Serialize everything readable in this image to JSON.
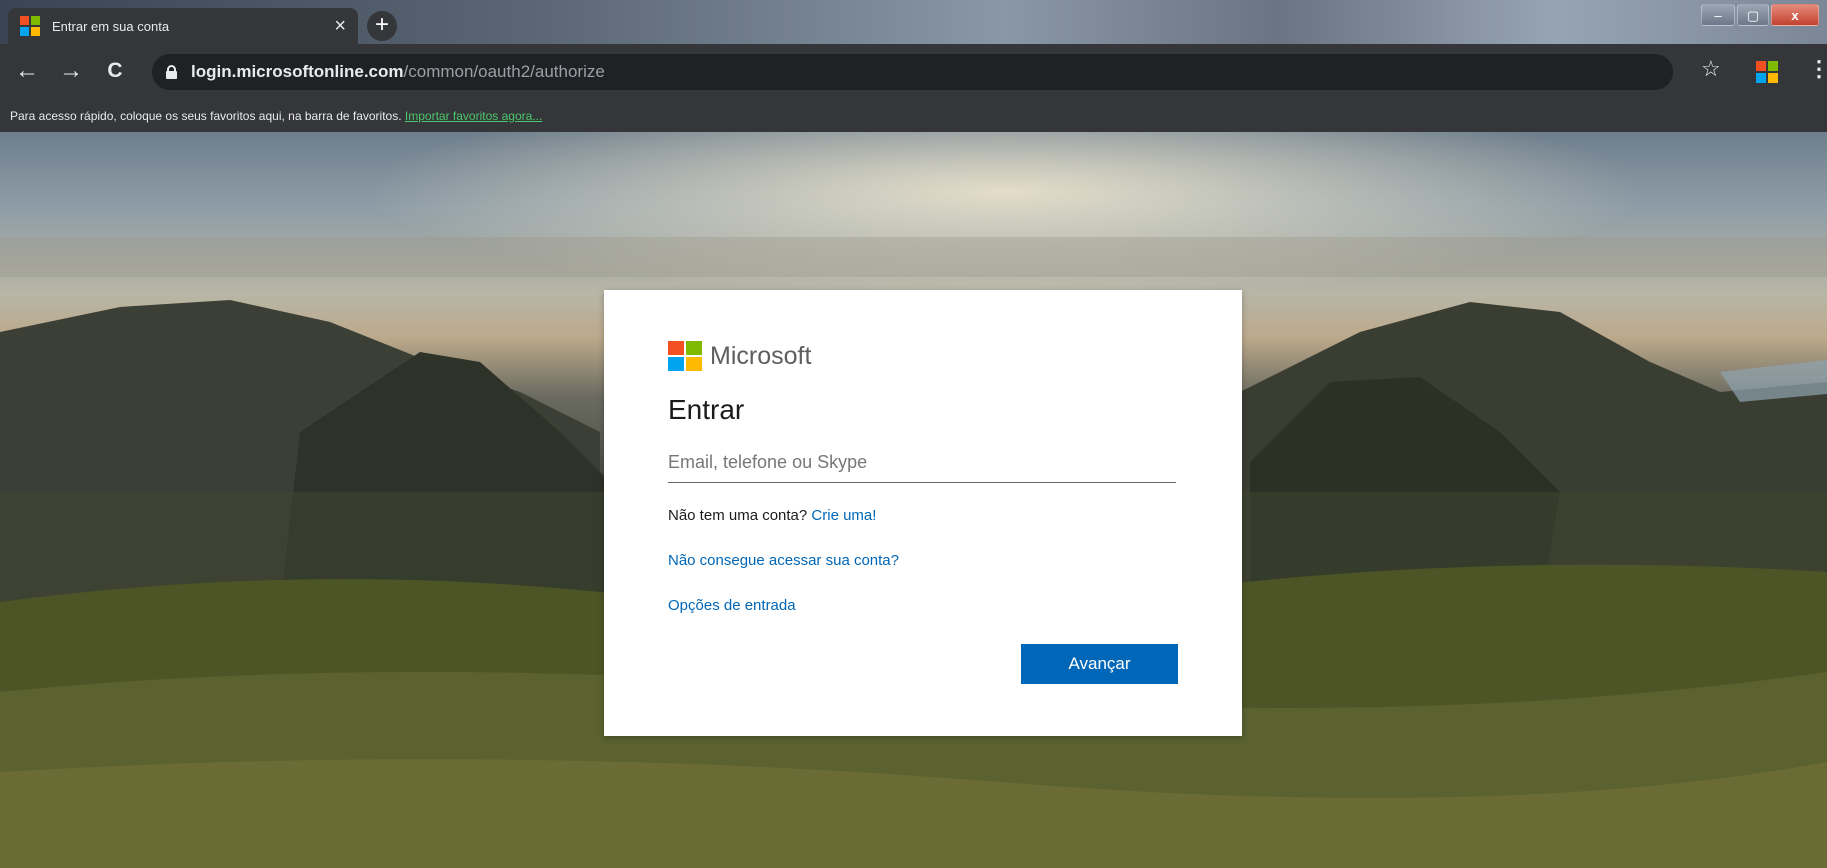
{
  "browser": {
    "tab_title": "Entrar em sua conta",
    "tab_close": "×",
    "new_tab": "+",
    "url_host": "login.microsoftonline.com",
    "url_path": "/common/oauth2/authorize",
    "back": "←",
    "forward": "→",
    "reload": "C",
    "star": "☆",
    "menu": "⋮",
    "window_controls": {
      "minimize": "–",
      "maximize": "▢",
      "close": "x"
    },
    "bookmarks_bar": {
      "text": "Para acesso rápido, coloque os seus favoritos aqui, na barra de favoritos.",
      "link": "Importar favoritos agora..."
    }
  },
  "signin": {
    "brand": "Microsoft",
    "heading": "Entrar",
    "email_placeholder": "Email, telefone ou Skype",
    "no_account_text": "Não tem uma conta?",
    "create_link": "Crie uma!",
    "cant_access_link": "Não consegue acessar sua conta?",
    "signin_options_link": "Opções de entrada",
    "next_button": "Avançar"
  },
  "colors": {
    "ms_red": "#f25022",
    "ms_green": "#7fba00",
    "ms_blue": "#00a4ef",
    "ms_yellow": "#ffb900",
    "primary_button": "#0067b8",
    "link": "#0067b8"
  }
}
